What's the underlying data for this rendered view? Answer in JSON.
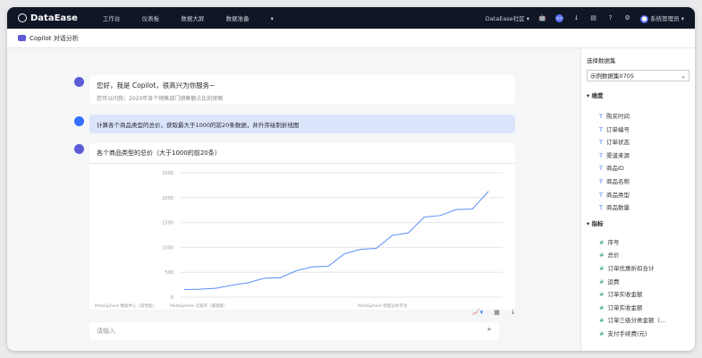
{
  "header": {
    "brand": "DataEase",
    "nav": [
      "工作台",
      "仪表板",
      "数据大屏",
      "数据准备"
    ],
    "community": "DataEase社区",
    "user": "系统管理员"
  },
  "subheader": {
    "title": "Copilot 对话分析"
  },
  "chat": {
    "greeting": "您好，我是 Copilot，很高兴为你服务~",
    "hint": "您可以问我：2020年各个销售部门销售额占比的饼图",
    "question": "计算各个商品类型的总价，获取最大于1000的前20条数据，并升序绘制折线图",
    "answer_title": "各个商品类型的总价（大于1000的前20条）",
    "input_placeholder": "请输入"
  },
  "chart_data": {
    "type": "line",
    "color": "#5b8ff9",
    "ylim": [
      0,
      2500
    ],
    "yticks": [
      0,
      500,
      1000,
      1500,
      2000,
      2500
    ],
    "x_labels": [
      "MetaSphere 数据中心（高性能）",
      "MetaSphere 云服务（基础版）",
      "MetaSphere 智能分析平台"
    ],
    "values": [
      150,
      160,
      180,
      240,
      290,
      380,
      390,
      530,
      610,
      620,
      870,
      960,
      980,
      1240,
      1290,
      1610,
      1640,
      1760,
      1770,
      2120
    ]
  },
  "sidebar": {
    "title": "选择数据集",
    "dataset": "示例数据集0705",
    "dim_label": "维度",
    "dimensions": [
      "购买时间",
      "订单编号",
      "订单状态",
      "渠道来源",
      "商品ID",
      "商品名称",
      "商品类型",
      "商品数量"
    ],
    "mea_label": "指标",
    "measures": [
      "序号",
      "总价",
      "订单优惠折扣合计",
      "运费",
      "订单实收金额",
      "订单实收金额",
      "订单三级分类金额（...",
      "支付手续费(元)"
    ]
  }
}
